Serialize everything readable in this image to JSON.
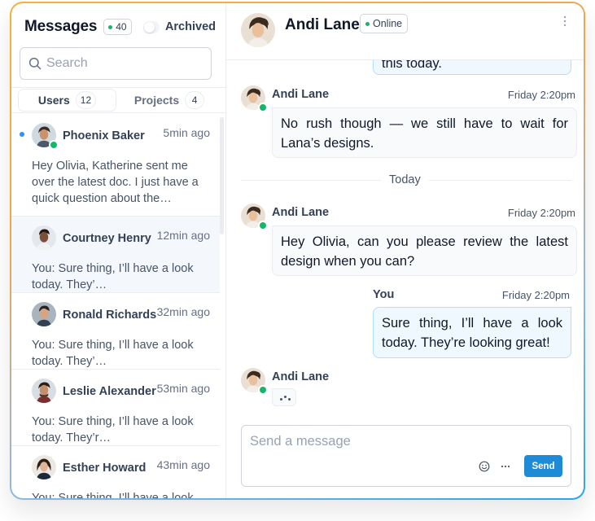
{
  "sidebar": {
    "title": "Messages",
    "unread_count": "40",
    "archived_label": "Archived",
    "search_placeholder": "Search",
    "tabs": [
      {
        "label": "Users",
        "count": "12",
        "active": true
      },
      {
        "label": "Projects",
        "count": "4",
        "active": false
      }
    ],
    "conversations": [
      {
        "name": "Phoenix Baker",
        "time": "5min ago",
        "preview": "Hey Olivia, Katherine sent me over the latest doc. I just have a quick question about the…",
        "unread": true,
        "online": true
      },
      {
        "name": "Courtney Henry",
        "time": "12min ago",
        "preview": "You: Sure thing, I’ll have a look today. They’…",
        "selected": true
      },
      {
        "name": "Ronald Richards",
        "time": "32min ago",
        "preview": "You: Sure thing, I’ll have a look today. They’…"
      },
      {
        "name": "Leslie Alexander",
        "time": "53min ago",
        "preview": "You: Sure thing, I’ll have a look today. They’r…"
      },
      {
        "name": "Esther Howard",
        "time": "43min ago",
        "preview": "You: Sure thing, I’ll have a look"
      }
    ]
  },
  "chat": {
    "contact_name": "Andi Lane",
    "contact_status": "Online",
    "messages": [
      {
        "text": "this today."
      },
      {
        "sender": "Andi Lane",
        "time": "Friday 2:20pm",
        "text": "No rush though — we still have to wait for Lana’s designs."
      },
      {
        "sender": "Andi Lane",
        "time": "Friday 2:20pm",
        "text": "Hey Olivia, can you please review the latest design when you can?"
      },
      {
        "sender": "You",
        "time": "Friday 2:20pm",
        "text": "Sure thing, I’ll have a look today. They’re looking great!"
      },
      {
        "sender": "Andi Lane",
        "typing": true
      }
    ],
    "divider_label": "Today",
    "composer": {
      "placeholder": "Send a message",
      "send_label": "Send"
    }
  },
  "colors": {
    "accent": "#1f8bd6",
    "online": "#12b76a",
    "unread_dot": "#2e90fa",
    "frame_gradient_start": "#f7b23b",
    "frame_gradient_end": "#2aa6e8"
  },
  "icons": [
    "search-icon",
    "emoji-icon",
    "more-dots-icon",
    "kebab-menu-icon"
  ]
}
